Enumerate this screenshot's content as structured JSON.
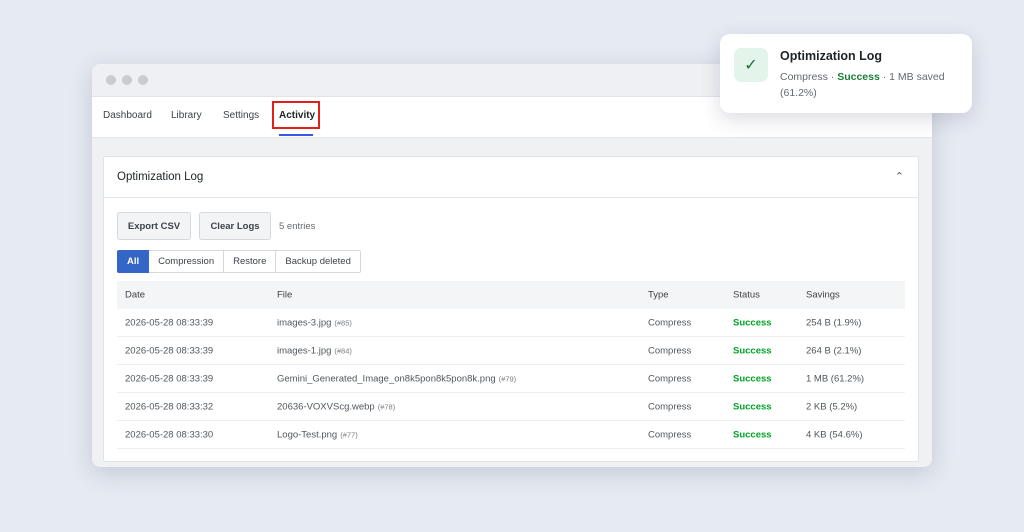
{
  "nav": {
    "tabs": [
      "Dashboard",
      "Library",
      "Settings",
      "Activity"
    ],
    "active": "Activity"
  },
  "card": {
    "title": "Optimization Log",
    "export_label": "Export CSV",
    "clear_label": "Clear Logs",
    "entries": "5 entries",
    "filters": [
      "All",
      "Compression",
      "Restore",
      "Backup deleted"
    ]
  },
  "table": {
    "headers": [
      "Date",
      "File",
      "Type",
      "Status",
      "Savings"
    ],
    "rows": [
      {
        "date": "2026-05-28 08:33:39",
        "file": "images-3.jpg",
        "id": "(#85)",
        "type": "Compress",
        "status": "Success",
        "savings": "254 B (1.9%)"
      },
      {
        "date": "2026-05-28 08:33:39",
        "file": "images-1.jpg",
        "id": "(#84)",
        "type": "Compress",
        "status": "Success",
        "savings": "264 B (2.1%)"
      },
      {
        "date": "2026-05-28 08:33:39",
        "file": "Gemini_Generated_Image_on8k5pon8k5pon8k.png",
        "id": "(#79)",
        "type": "Compress",
        "status": "Success",
        "savings": "1 MB (61.2%)"
      },
      {
        "date": "2026-05-28 08:33:32",
        "file": "20636-VOXVScg.webp",
        "id": "(#78)",
        "type": "Compress",
        "status": "Success",
        "savings": "2 KB (5.2%)"
      },
      {
        "date": "2026-05-28 08:33:30",
        "file": "Logo-Test.png",
        "id": "(#77)",
        "type": "Compress",
        "status": "Success",
        "savings": "4 KB (54.6%)"
      }
    ]
  },
  "toast": {
    "title": "Optimization Log",
    "type": "Compress",
    "sep": "·",
    "status": "Success",
    "detail": "1 MB saved (61.2%)",
    "icon": "checkmark-icon"
  },
  "colors": {
    "accent": "#3366c6",
    "success": "#00a32a",
    "highlight": "#e1201c"
  }
}
